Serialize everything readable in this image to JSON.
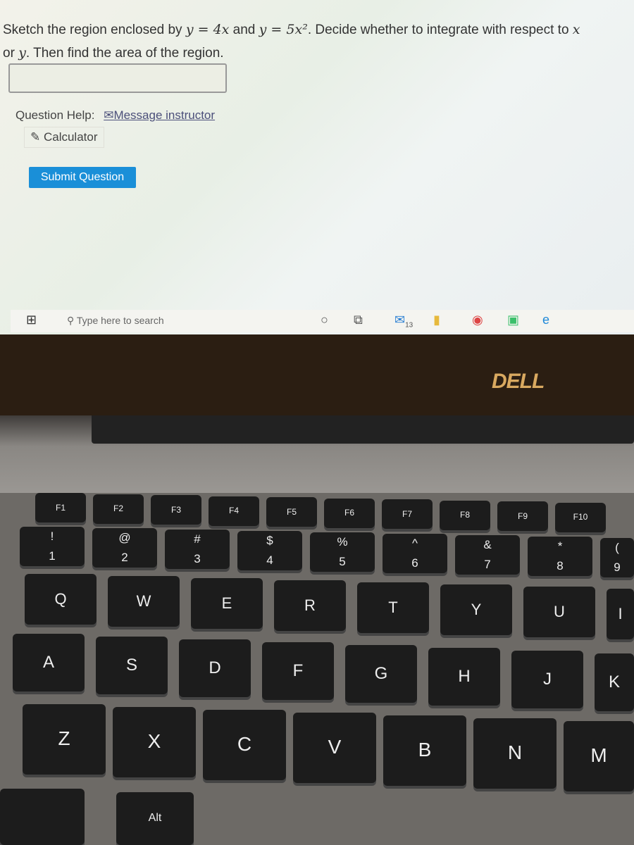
{
  "question": {
    "text_before": "Sketch the region enclosed by ",
    "eq1": "y = 4x",
    "mid": " and ",
    "eq2": "y = 5x²",
    "text_after": ". Decide whether to integrate with respect to ",
    "var_x": "x",
    "line2_pre": "or ",
    "var_y": "y",
    "line2_post": ". Then find the area of the region."
  },
  "answer": {
    "value": ""
  },
  "help": {
    "label": "Question Help:",
    "message": "Message instructor",
    "calculator": "Calculator"
  },
  "submit_label": "Submit Question",
  "taskbar": {
    "search_placeholder": "Type here to search",
    "mail_badge": "13"
  },
  "bezel": {
    "logo": "DELL"
  },
  "keyboard": {
    "fn_row": [
      "F1",
      "F2",
      "F3",
      "F4",
      "F5",
      "F6",
      "F7",
      "F8",
      "F9",
      "F10"
    ],
    "number_row": [
      [
        "!",
        "1"
      ],
      [
        "@",
        "2"
      ],
      [
        "#",
        "3"
      ],
      [
        "$",
        "4"
      ],
      [
        "%",
        "5"
      ],
      [
        "^",
        "6"
      ],
      [
        "&",
        "7"
      ],
      [
        "*",
        "8"
      ],
      [
        "(",
        "9"
      ]
    ],
    "qwerty_row": [
      "Q",
      "W",
      "E",
      "R",
      "T",
      "Y",
      "U",
      "I"
    ],
    "home_row": [
      "A",
      "S",
      "D",
      "F",
      "G",
      "H",
      "J",
      "K"
    ],
    "bottom_row": [
      "Z",
      "X",
      "C",
      "V",
      "B",
      "N",
      "M"
    ],
    "alt_label": "Alt"
  }
}
